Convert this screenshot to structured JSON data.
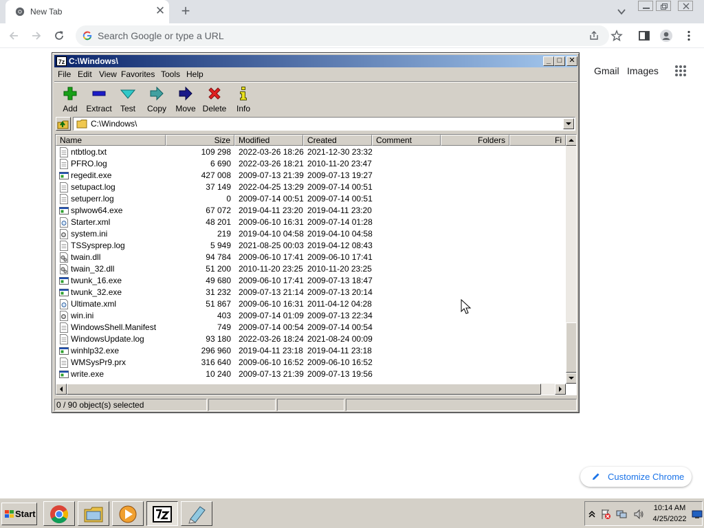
{
  "browser": {
    "tab_title": "New Tab",
    "omnibox_placeholder": "Search Google or type a URL"
  },
  "ntp": {
    "gmail": "Gmail",
    "images": "Images",
    "customize": "Customize Chrome"
  },
  "sevenzip": {
    "title": "C:\\Windows\\",
    "title_icon_text": "7z",
    "menu": [
      "File",
      "Edit",
      "View",
      "Favorites",
      "Tools",
      "Help"
    ],
    "toolbar": [
      "Add",
      "Extract",
      "Test",
      "Copy",
      "Move",
      "Delete",
      "Info"
    ],
    "path": "C:\\Windows\\",
    "columns": [
      "Name",
      "Size",
      "Modified",
      "Created",
      "Comment",
      "Folders",
      "Fi"
    ],
    "rows": [
      {
        "name": "ntbtlog.txt",
        "size": "109 298",
        "modified": "2022-03-26 18:26",
        "created": "2021-12-30 23:32",
        "icon": "text-file-icon"
      },
      {
        "name": "PFRO.log",
        "size": "6 690",
        "modified": "2022-03-26 18:21",
        "created": "2010-11-20 23:47",
        "icon": "text-file-icon"
      },
      {
        "name": "regedit.exe",
        "size": "427 008",
        "modified": "2009-07-13 21:39",
        "created": "2009-07-13 19:27",
        "icon": "exe-file-icon"
      },
      {
        "name": "setupact.log",
        "size": "37 149",
        "modified": "2022-04-25 13:29",
        "created": "2009-07-14 00:51",
        "icon": "text-file-icon"
      },
      {
        "name": "setuperr.log",
        "size": "0",
        "modified": "2009-07-14 00:51",
        "created": "2009-07-14 00:51",
        "icon": "text-file-icon"
      },
      {
        "name": "splwow64.exe",
        "size": "67 072",
        "modified": "2019-04-11 23:20",
        "created": "2019-04-11 23:20",
        "icon": "exe-file-icon"
      },
      {
        "name": "Starter.xml",
        "size": "48 201",
        "modified": "2009-06-10 16:31",
        "created": "2009-07-14 01:28",
        "icon": "xml-file-icon"
      },
      {
        "name": "system.ini",
        "size": "219",
        "modified": "2019-04-10 04:58",
        "created": "2019-04-10 04:58",
        "icon": "ini-file-icon"
      },
      {
        "name": "TSSysprep.log",
        "size": "5 949",
        "modified": "2021-08-25 00:03",
        "created": "2019-04-12 08:43",
        "icon": "text-file-icon"
      },
      {
        "name": "twain.dll",
        "size": "94 784",
        "modified": "2009-06-10 17:41",
        "created": "2009-06-10 17:41",
        "icon": "dll-file-icon"
      },
      {
        "name": "twain_32.dll",
        "size": "51 200",
        "modified": "2010-11-20 23:25",
        "created": "2010-11-20 23:25",
        "icon": "dll-file-icon"
      },
      {
        "name": "twunk_16.exe",
        "size": "49 680",
        "modified": "2009-06-10 17:41",
        "created": "2009-07-13 18:47",
        "icon": "exe-file-icon"
      },
      {
        "name": "twunk_32.exe",
        "size": "31 232",
        "modified": "2009-07-13 21:14",
        "created": "2009-07-13 20:14",
        "icon": "exe-file-icon"
      },
      {
        "name": "Ultimate.xml",
        "size": "51 867",
        "modified": "2009-06-10 16:31",
        "created": "2011-04-12 04:28",
        "icon": "xml-file-icon"
      },
      {
        "name": "win.ini",
        "size": "403",
        "modified": "2009-07-14 01:09",
        "created": "2009-07-13 22:34",
        "icon": "ini-file-icon"
      },
      {
        "name": "WindowsShell.Manifest",
        "size": "749",
        "modified": "2009-07-14 00:54",
        "created": "2009-07-14 00:54",
        "icon": "text-file-icon"
      },
      {
        "name": "WindowsUpdate.log",
        "size": "93 180",
        "modified": "2022-03-26 18:24",
        "created": "2021-08-24 00:09",
        "icon": "text-file-icon"
      },
      {
        "name": "winhlp32.exe",
        "size": "296 960",
        "modified": "2019-04-11 23:18",
        "created": "2019-04-11 23:18",
        "icon": "exe-file-icon"
      },
      {
        "name": "WMSysPr9.prx",
        "size": "316 640",
        "modified": "2009-06-10 16:52",
        "created": "2009-06-10 16:52",
        "icon": "text-file-icon"
      },
      {
        "name": "write.exe",
        "size": "10 240",
        "modified": "2009-07-13 21:39",
        "created": "2009-07-13 19:56",
        "icon": "exe-file-icon"
      }
    ],
    "status": "0 / 90 object(s) selected"
  },
  "taskbar": {
    "start": "Start",
    "time": "10:14 AM",
    "date": "4/25/2022"
  },
  "colors": {
    "titlebar_start": "#0a246a",
    "titlebar_end": "#a6caf0",
    "window_face": "#d4d0c8",
    "chrome_tabstrip": "#dee1e6",
    "chrome_accent": "#1a73e8"
  }
}
